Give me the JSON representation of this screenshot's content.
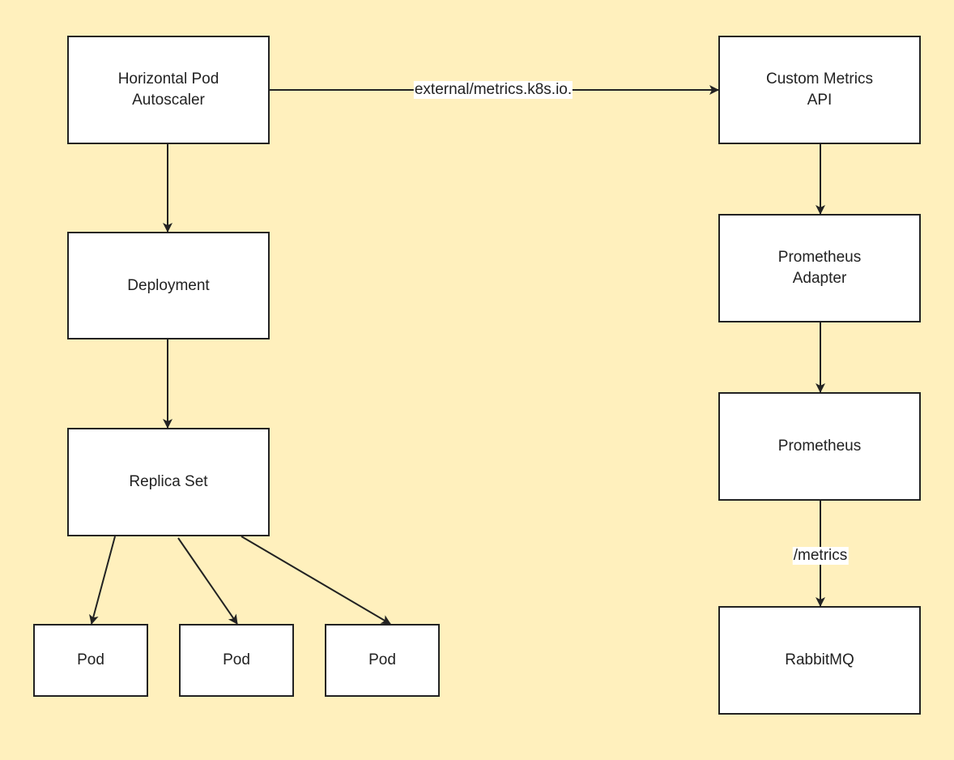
{
  "diagram": {
    "background_color": "#fff0bd",
    "node_fill": "#ffffff",
    "stroke_color": "#222222",
    "nodes": [
      {
        "id": "hpa",
        "label": "Horizontal Pod\nAutoscaler"
      },
      {
        "id": "deployment",
        "label": "Deployment"
      },
      {
        "id": "replicaset",
        "label": "Replica Set"
      },
      {
        "id": "pod1",
        "label": "Pod"
      },
      {
        "id": "pod2",
        "label": "Pod"
      },
      {
        "id": "pod3",
        "label": "Pod"
      },
      {
        "id": "custom_metrics_api",
        "label": "Custom Metrics\nAPI"
      },
      {
        "id": "prometheus_adapter",
        "label": "Prometheus\nAdapter"
      },
      {
        "id": "prometheus",
        "label": "Prometheus"
      },
      {
        "id": "rabbitmq",
        "label": "RabbitMQ"
      }
    ],
    "edges": [
      {
        "from": "hpa",
        "to": "custom_metrics_api",
        "label": "external/metrics.k8s.io."
      },
      {
        "from": "hpa",
        "to": "deployment",
        "label": ""
      },
      {
        "from": "deployment",
        "to": "replicaset",
        "label": ""
      },
      {
        "from": "replicaset",
        "to": "pod1",
        "label": ""
      },
      {
        "from": "replicaset",
        "to": "pod2",
        "label": ""
      },
      {
        "from": "replicaset",
        "to": "pod3",
        "label": ""
      },
      {
        "from": "custom_metrics_api",
        "to": "prometheus_adapter",
        "label": ""
      },
      {
        "from": "prometheus_adapter",
        "to": "prometheus",
        "label": ""
      },
      {
        "from": "prometheus",
        "to": "rabbitmq",
        "label": "/metrics"
      }
    ]
  }
}
